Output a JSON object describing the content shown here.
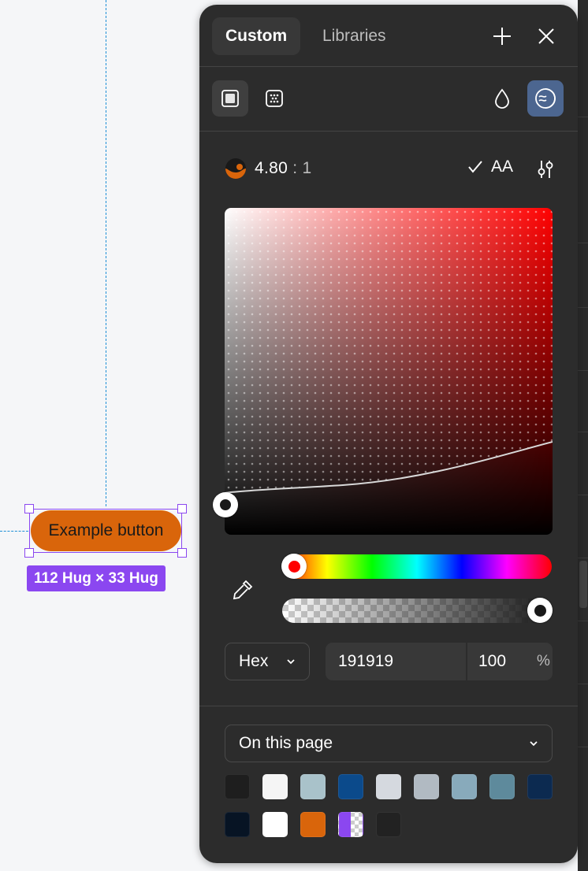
{
  "canvas": {
    "button_label": "Example button",
    "size_badge": "112 Hug × 33 Hug",
    "button_color": "#d9650b",
    "selection_color": "#8b47f0",
    "guide_color": "#1e8fd6"
  },
  "panel": {
    "tabs": [
      {
        "label": "Custom",
        "active": true
      },
      {
        "label": "Libraries",
        "active": false
      }
    ],
    "header_icons": [
      "plus-icon",
      "close-icon"
    ],
    "fill_type_icons": [
      "solid-fill-icon",
      "image-fill-icon"
    ],
    "mode_icons": [
      "droplet-icon",
      "contrast-check-icon"
    ],
    "contrast": {
      "ratio_value": "4.80",
      "ratio_sep": ":",
      "ratio_base": "1",
      "rating": "AA",
      "settings_icon": "sliders-icon"
    },
    "picker": {
      "hue_color": "#ff0000",
      "hue_position": 0,
      "alpha_position": 1.0,
      "current_color": "#191919"
    },
    "format": {
      "selected": "Hex",
      "hex_value": "191919",
      "alpha_value": "100",
      "alpha_unit": "%"
    },
    "library_source": "On this page",
    "swatches": [
      "#1e1e1e",
      "#f5f5f5",
      "#a9c2ca",
      "#0b4a8b",
      "#d5d9df",
      "#b1bac2",
      "#88aabb",
      "#5e8a9c",
      "#0c2a50",
      "#071424",
      "#ffffff",
      "#d9650b",
      "purple-transparent",
      "#222222"
    ]
  }
}
